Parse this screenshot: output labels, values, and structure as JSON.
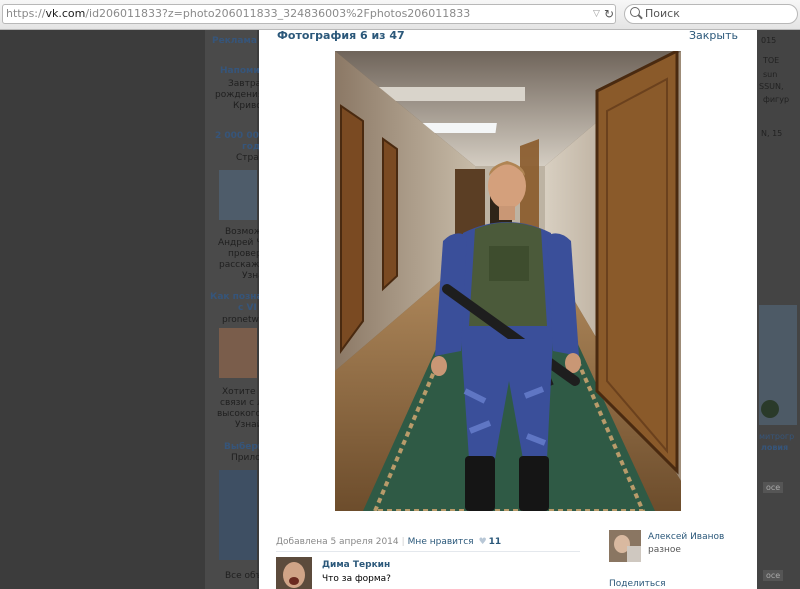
{
  "browser": {
    "url_scheme": "https://",
    "url_host": "vk.com",
    "url_path": "/id206011833?z=photo206011833_324836003%2Fphotos206011833",
    "search_placeholder": "Поиск"
  },
  "background": {
    "left": {
      "ad_header": "Реклама",
      "ad1_title": "Напомин",
      "ad1_lines": [
        "Завтра",
        "рождения",
        "Кривс"
      ],
      "ad2_title": [
        "2 000 000",
        "год"
      ],
      "ad2_sub": "Стран",
      "ad2_lines": [
        "Возмож",
        "Андрей Ч",
        "провер",
        "расскаж",
        "Узнай"
      ],
      "ad3_title": [
        "Как познак",
        "с VI"
      ],
      "ad3_sub": "pronetwo",
      "ad3_lines": [
        "Хотите по",
        "связи с л",
        "высокого",
        "Узнайт"
      ],
      "ad4_title": "Выбери",
      "ad4_sub": "Прилож",
      "footer": "Все объя"
    },
    "right": {
      "lines": [
        "015",
        "ТОЕ",
        "sun",
        "SSUN,",
        "фигур",
        "N, 15"
      ],
      "bottom_lines": [
        "митрогр",
        "ловия"
      ],
      "buttons": [
        "осе",
        "осе"
      ]
    }
  },
  "viewer": {
    "counter": "Фотография 6 из 47",
    "close_label": "Закрыть",
    "added": "Добавлена 5 апреля 2014",
    "like_label": "Мне нравится",
    "like_count": "11",
    "comment": {
      "author": "Дима Теркин",
      "text": "Что за форма?"
    },
    "author": {
      "name": "Алексей Иванов",
      "album": "разное"
    },
    "share_label": "Поделиться"
  },
  "colors": {
    "link": "#2b587a",
    "overlay": "#3c3c3c"
  }
}
